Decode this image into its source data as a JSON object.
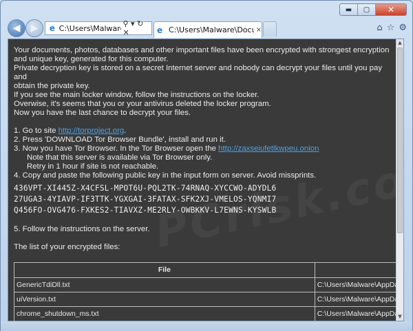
{
  "browser": {
    "caption": {
      "minimize": "▬",
      "maximize": "▢",
      "close": "✕"
    },
    "address_url": "C:\\Users\\Malware\\",
    "address_controls": "⚲ ▾ ↻ ✕",
    "tab_title": "C:\\Users\\Malware\\Docume...",
    "tab_close": "×",
    "tools": {
      "home": "⌂",
      "favorites": "☆",
      "settings": "⚙"
    }
  },
  "note": {
    "intro": [
      "Your documents, photos, databases and other important files have been encrypted with strongest encryption",
      "and unique key, generated for this computer.",
      "Private decryption key is stored on a secret Internet server and nobody can decrypt your files until you pay and",
      "obtain the private key.",
      "If you see the main locker window, follow the instructions on the locker.",
      "Overwise, it's seems that you or your antivirus deleted the locker program.",
      "Now you have the last chance to decrypt your files."
    ],
    "step1_prefix": "1. Go to site ",
    "step1_link": "http://torproject.org",
    "step1_suffix": ".",
    "step2": "2. Press 'DOWNLOAD Tor Browser Bundle', install and run it.",
    "step3_prefix": "3. Now you have Tor Browser. In the Tor Browser open the ",
    "step3_link": "http://zaxseiufetlkwpeu.onion",
    "step3_note1": "Note that this server is available via Tor Browser only.",
    "step3_note2": "Retry in 1 hour if site is not reachable.",
    "step4": "4. Copy and paste the following public key in the input form on server. Avoid missprints.",
    "public_key": [
      "436VPT-XI445Z-X4CFSL-MPOT6U-PQL2TK-74RNAQ-XYCCWO-ADYDL6",
      "27UGA3-4YIAVP-IF3TTK-YGXGAI-3FATAX-SFK2XJ-VMELOS-YQNMI7",
      "Q456FO-OVG476-FXKES2-TIAVXZ-ME2RLY-OWBKKV-L7EWNS-KYSWLB"
    ],
    "step5": "5. Follow the instructions on the server.",
    "files_heading": "The list of your encrypted files:"
  },
  "files_table": {
    "header": [
      "File",
      ""
    ],
    "rows": [
      [
        "GenericTdiDll.txt",
        "C:\\Users\\Malware\\AppData"
      ],
      [
        "uiVersion.txt",
        "C:\\Users\\Malware\\AppData"
      ],
      [
        "chrome_shutdown_ms.txt",
        "C:\\Users\\Malware\\AppData"
      ]
    ]
  },
  "watermark": "PCrisk.com"
}
